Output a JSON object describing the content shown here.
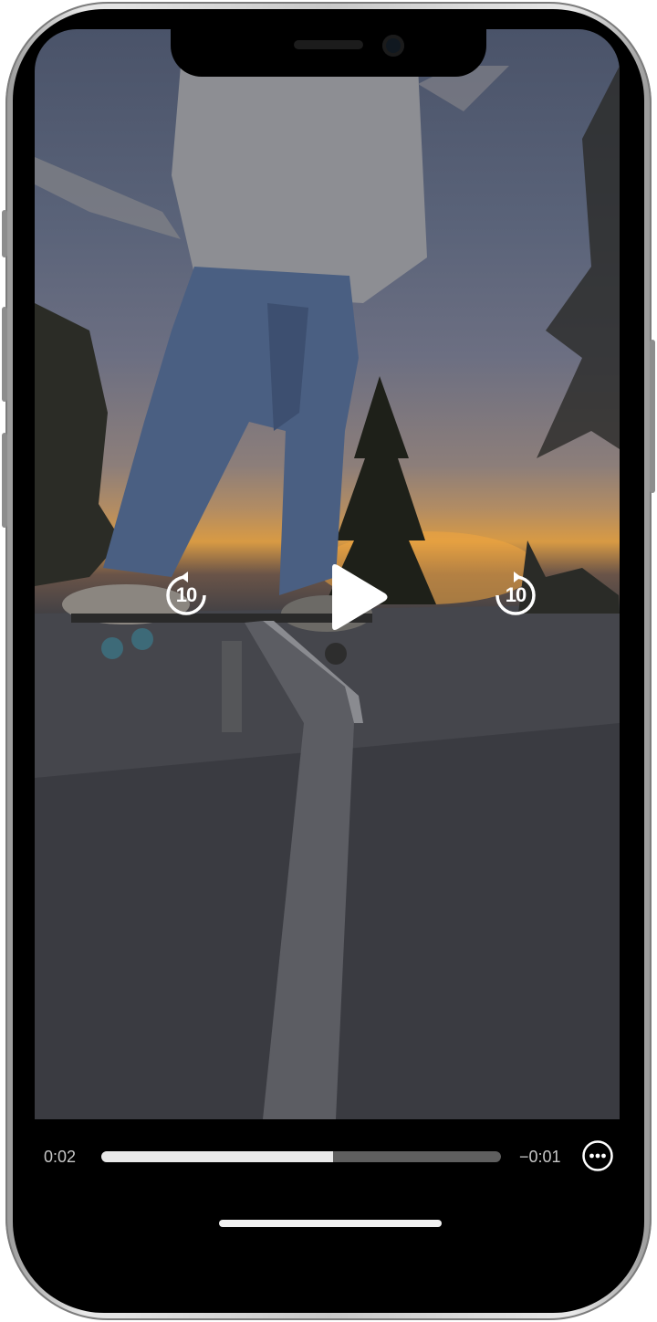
{
  "player": {
    "elapsed_time": "0:02",
    "remaining_time": "−0:01",
    "progress_fraction": 0.58,
    "skip_back_label": "10",
    "skip_forward_label": "10"
  },
  "icons": {
    "play": "play-icon",
    "skip_back": "rotate-ccw-icon",
    "skip_forward": "rotate-cw-icon",
    "more": "ellipsis-circle-icon"
  },
  "colors": {
    "progress_fill": "#e9e9e9",
    "progress_track": "#5f5f5f",
    "background": "#000000"
  }
}
